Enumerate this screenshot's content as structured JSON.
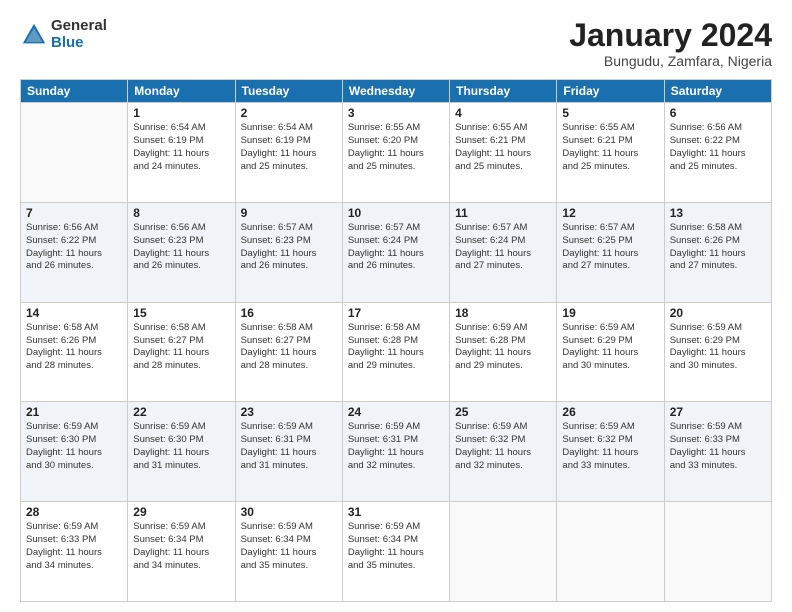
{
  "logo": {
    "general": "General",
    "blue": "Blue"
  },
  "title": "January 2024",
  "subtitle": "Bungudu, Zamfara, Nigeria",
  "headers": [
    "Sunday",
    "Monday",
    "Tuesday",
    "Wednesday",
    "Thursday",
    "Friday",
    "Saturday"
  ],
  "weeks": [
    [
      {
        "day": "",
        "info": ""
      },
      {
        "day": "1",
        "info": "Sunrise: 6:54 AM\nSunset: 6:19 PM\nDaylight: 11 hours\nand 24 minutes."
      },
      {
        "day": "2",
        "info": "Sunrise: 6:54 AM\nSunset: 6:19 PM\nDaylight: 11 hours\nand 25 minutes."
      },
      {
        "day": "3",
        "info": "Sunrise: 6:55 AM\nSunset: 6:20 PM\nDaylight: 11 hours\nand 25 minutes."
      },
      {
        "day": "4",
        "info": "Sunrise: 6:55 AM\nSunset: 6:21 PM\nDaylight: 11 hours\nand 25 minutes."
      },
      {
        "day": "5",
        "info": "Sunrise: 6:55 AM\nSunset: 6:21 PM\nDaylight: 11 hours\nand 25 minutes."
      },
      {
        "day": "6",
        "info": "Sunrise: 6:56 AM\nSunset: 6:22 PM\nDaylight: 11 hours\nand 25 minutes."
      }
    ],
    [
      {
        "day": "7",
        "info": "Sunrise: 6:56 AM\nSunset: 6:22 PM\nDaylight: 11 hours\nand 26 minutes."
      },
      {
        "day": "8",
        "info": "Sunrise: 6:56 AM\nSunset: 6:23 PM\nDaylight: 11 hours\nand 26 minutes."
      },
      {
        "day": "9",
        "info": "Sunrise: 6:57 AM\nSunset: 6:23 PM\nDaylight: 11 hours\nand 26 minutes."
      },
      {
        "day": "10",
        "info": "Sunrise: 6:57 AM\nSunset: 6:24 PM\nDaylight: 11 hours\nand 26 minutes."
      },
      {
        "day": "11",
        "info": "Sunrise: 6:57 AM\nSunset: 6:24 PM\nDaylight: 11 hours\nand 27 minutes."
      },
      {
        "day": "12",
        "info": "Sunrise: 6:57 AM\nSunset: 6:25 PM\nDaylight: 11 hours\nand 27 minutes."
      },
      {
        "day": "13",
        "info": "Sunrise: 6:58 AM\nSunset: 6:26 PM\nDaylight: 11 hours\nand 27 minutes."
      }
    ],
    [
      {
        "day": "14",
        "info": "Sunrise: 6:58 AM\nSunset: 6:26 PM\nDaylight: 11 hours\nand 28 minutes."
      },
      {
        "day": "15",
        "info": "Sunrise: 6:58 AM\nSunset: 6:27 PM\nDaylight: 11 hours\nand 28 minutes."
      },
      {
        "day": "16",
        "info": "Sunrise: 6:58 AM\nSunset: 6:27 PM\nDaylight: 11 hours\nand 28 minutes."
      },
      {
        "day": "17",
        "info": "Sunrise: 6:58 AM\nSunset: 6:28 PM\nDaylight: 11 hours\nand 29 minutes."
      },
      {
        "day": "18",
        "info": "Sunrise: 6:59 AM\nSunset: 6:28 PM\nDaylight: 11 hours\nand 29 minutes."
      },
      {
        "day": "19",
        "info": "Sunrise: 6:59 AM\nSunset: 6:29 PM\nDaylight: 11 hours\nand 30 minutes."
      },
      {
        "day": "20",
        "info": "Sunrise: 6:59 AM\nSunset: 6:29 PM\nDaylight: 11 hours\nand 30 minutes."
      }
    ],
    [
      {
        "day": "21",
        "info": "Sunrise: 6:59 AM\nSunset: 6:30 PM\nDaylight: 11 hours\nand 30 minutes."
      },
      {
        "day": "22",
        "info": "Sunrise: 6:59 AM\nSunset: 6:30 PM\nDaylight: 11 hours\nand 31 minutes."
      },
      {
        "day": "23",
        "info": "Sunrise: 6:59 AM\nSunset: 6:31 PM\nDaylight: 11 hours\nand 31 minutes."
      },
      {
        "day": "24",
        "info": "Sunrise: 6:59 AM\nSunset: 6:31 PM\nDaylight: 11 hours\nand 32 minutes."
      },
      {
        "day": "25",
        "info": "Sunrise: 6:59 AM\nSunset: 6:32 PM\nDaylight: 11 hours\nand 32 minutes."
      },
      {
        "day": "26",
        "info": "Sunrise: 6:59 AM\nSunset: 6:32 PM\nDaylight: 11 hours\nand 33 minutes."
      },
      {
        "day": "27",
        "info": "Sunrise: 6:59 AM\nSunset: 6:33 PM\nDaylight: 11 hours\nand 33 minutes."
      }
    ],
    [
      {
        "day": "28",
        "info": "Sunrise: 6:59 AM\nSunset: 6:33 PM\nDaylight: 11 hours\nand 34 minutes."
      },
      {
        "day": "29",
        "info": "Sunrise: 6:59 AM\nSunset: 6:34 PM\nDaylight: 11 hours\nand 34 minutes."
      },
      {
        "day": "30",
        "info": "Sunrise: 6:59 AM\nSunset: 6:34 PM\nDaylight: 11 hours\nand 35 minutes."
      },
      {
        "day": "31",
        "info": "Sunrise: 6:59 AM\nSunset: 6:34 PM\nDaylight: 11 hours\nand 35 minutes."
      },
      {
        "day": "",
        "info": ""
      },
      {
        "day": "",
        "info": ""
      },
      {
        "day": "",
        "info": ""
      }
    ]
  ]
}
